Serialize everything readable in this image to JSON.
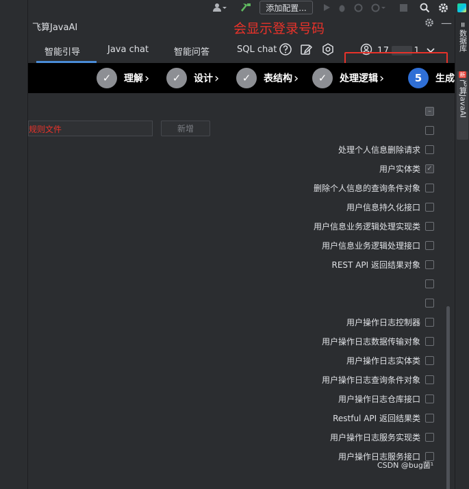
{
  "ide_toolbar": {
    "run_config_label": "添加配置..."
  },
  "right_strip": {
    "database_tab": "数据库",
    "plugin_tab": "飞算JavaAI",
    "plugin_badge": "新"
  },
  "panel": {
    "title": "飞算JavaAI"
  },
  "annotation": {
    "text": "会显示登录号码",
    "color": "#e8322a"
  },
  "tabs": [
    {
      "label": "智能引导",
      "active": true
    },
    {
      "label": "Java chat",
      "active": false
    },
    {
      "label": "智能问答",
      "active": false
    },
    {
      "label": "SQL chat",
      "active": false
    }
  ],
  "account": {
    "phone_prefix": "17",
    "phone_suffix": "1"
  },
  "steps": [
    {
      "label": "理解",
      "state": "done"
    },
    {
      "label": "设计",
      "state": "done"
    },
    {
      "label": "表结构",
      "state": "done"
    },
    {
      "label": "处理逻辑",
      "state": "done"
    },
    {
      "label": "生成",
      "state": "active",
      "number": "5"
    }
  ],
  "rules": {
    "input_value": "规则文件",
    "add_button": "新增"
  },
  "files": [
    {
      "label": "",
      "state": "partial"
    },
    {
      "label": "",
      "state": "unchecked"
    },
    {
      "label": "处理个人信息删除请求",
      "state": "unchecked"
    },
    {
      "label": "用户实体类",
      "state": "checked"
    },
    {
      "label": "删除个人信息的查询条件对象",
      "state": "unchecked"
    },
    {
      "label": "用户信息持久化接口",
      "state": "unchecked"
    },
    {
      "label": "用户信息业务逻辑处理实现类",
      "state": "unchecked"
    },
    {
      "label": "用户信息业务逻辑处理接口",
      "state": "unchecked"
    },
    {
      "label": "REST API 返回结果对象",
      "state": "unchecked"
    },
    {
      "label": "",
      "state": "unchecked"
    },
    {
      "label": "",
      "state": "unchecked"
    },
    {
      "label": "用户操作日志控制器",
      "state": "unchecked"
    },
    {
      "label": "用户操作日志数据传输对象",
      "state": "unchecked"
    },
    {
      "label": "用户操作日志实体类",
      "state": "unchecked"
    },
    {
      "label": "用户操作日志查询条件对象",
      "state": "unchecked"
    },
    {
      "label": "用户操作日志仓库接口",
      "state": "unchecked"
    },
    {
      "label": "Restful API 返回结果类",
      "state": "unchecked"
    },
    {
      "label": "用户操作日志服务实现类",
      "state": "unchecked"
    },
    {
      "label": "用户操作日志服务接口",
      "state": "unchecked"
    }
  ],
  "watermark": "CSDN @bug菌¹"
}
